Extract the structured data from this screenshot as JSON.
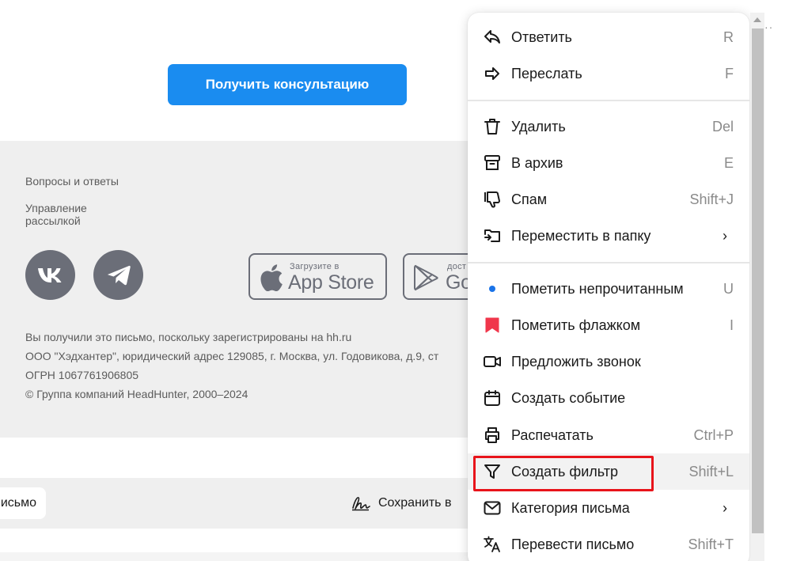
{
  "email": {
    "cta_button": "Получить консультацию",
    "footer_links": [
      "Вопросы и ответы",
      "Управление\nрассылкой"
    ],
    "social_icons": [
      "vk-icon",
      "telegram-icon"
    ],
    "app_store": {
      "small": "Загрузите в",
      "big": "App Store"
    },
    "google_play": {
      "small": "дост",
      "big": "Go"
    },
    "legal_lines": [
      "Вы получили это письмо, поскольку зарегистрированы на hh.ru",
      "ООО \"Хэдхантер\", юридический адрес 129085, г. Москва, ул. Годовикова, д.9, ст",
      "ОГРН 1067761906805",
      "© Группа компаний HeadHunter, 2000–2024"
    ]
  },
  "toolbar": {
    "letter_chip": "исьмо",
    "save_label": "Сохранить в"
  },
  "context_menu": {
    "groups": [
      [
        {
          "label": "Ответить",
          "shortcut": "R",
          "icon": "reply-icon"
        },
        {
          "label": "Переслать",
          "shortcut": "F",
          "icon": "forward-icon"
        }
      ],
      [
        {
          "label": "Удалить",
          "shortcut": "Del",
          "icon": "trash-icon"
        },
        {
          "label": "В архив",
          "shortcut": "E",
          "icon": "archive-icon"
        },
        {
          "label": "Спам",
          "shortcut": "Shift+J",
          "icon": "spam-icon"
        },
        {
          "label": "Переместить в папку",
          "shortcut": "›",
          "icon": "move-folder-icon"
        }
      ],
      [
        {
          "label": "Пометить непрочитанным",
          "shortcut": "U",
          "icon": "unread-dot-icon"
        },
        {
          "label": "Пометить флажком",
          "shortcut": "I",
          "icon": "flag-icon"
        },
        {
          "label": "Предложить звонок",
          "shortcut": "",
          "icon": "video-call-icon"
        },
        {
          "label": "Создать событие",
          "shortcut": "",
          "icon": "calendar-icon"
        },
        {
          "label": "Распечатать",
          "shortcut": "Ctrl+P",
          "icon": "print-icon"
        },
        {
          "label": "Создать фильтр",
          "shortcut": "Shift+L",
          "icon": "filter-icon"
        },
        {
          "label": "Категория письма",
          "shortcut": "›",
          "icon": "envelope-icon"
        },
        {
          "label": "Перевести письмо",
          "shortcut": "Shift+T",
          "icon": "translate-icon"
        }
      ]
    ]
  },
  "colors": {
    "primary_button": "#1a8cf0",
    "flag": "#f0364b",
    "unread_dot": "#1a73e8",
    "highlight": "#e8141b"
  }
}
